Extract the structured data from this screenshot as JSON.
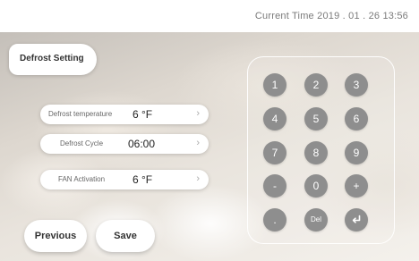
{
  "header": {
    "current_time_label": "Current Time 2019 . 01 . 26 13:56"
  },
  "settings": {
    "tab_label": "Defrost Setting",
    "fields": [
      {
        "label": "Defrost temperature",
        "value": "6 °F"
      },
      {
        "label": "Defrost Cycle",
        "value": "06:00"
      },
      {
        "label": "FAN Activation",
        "value": "6 °F"
      }
    ]
  },
  "actions": {
    "previous_label": "Previous",
    "save_label": "Save"
  },
  "keypad": {
    "keys": [
      "1",
      "2",
      "3",
      "4",
      "5",
      "6",
      "7",
      "8",
      "9",
      "-",
      "0",
      "+",
      ".",
      "Del",
      "enter"
    ]
  },
  "colors": {
    "key_fill": "#8e8e8e",
    "panel": "#ffffff"
  }
}
